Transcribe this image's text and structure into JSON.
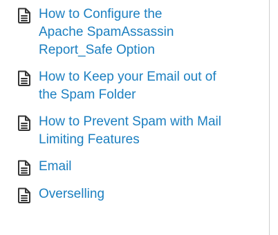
{
  "articles": [
    {
      "title": "How to Configure the Apache SpamAssassin Report_Safe Option",
      "icon": "document-icon"
    },
    {
      "title": "How to Keep your Email out of the Spam Folder",
      "icon": "document-icon"
    },
    {
      "title": "How to Prevent Spam with Mail Limiting Features",
      "icon": "document-icon"
    },
    {
      "title": "Email",
      "icon": "document-icon"
    },
    {
      "title": "Overselling",
      "icon": "document-icon"
    }
  ],
  "colors": {
    "link": "#1b7fc0",
    "icon": "#333333",
    "border": "#cfcfcf"
  }
}
